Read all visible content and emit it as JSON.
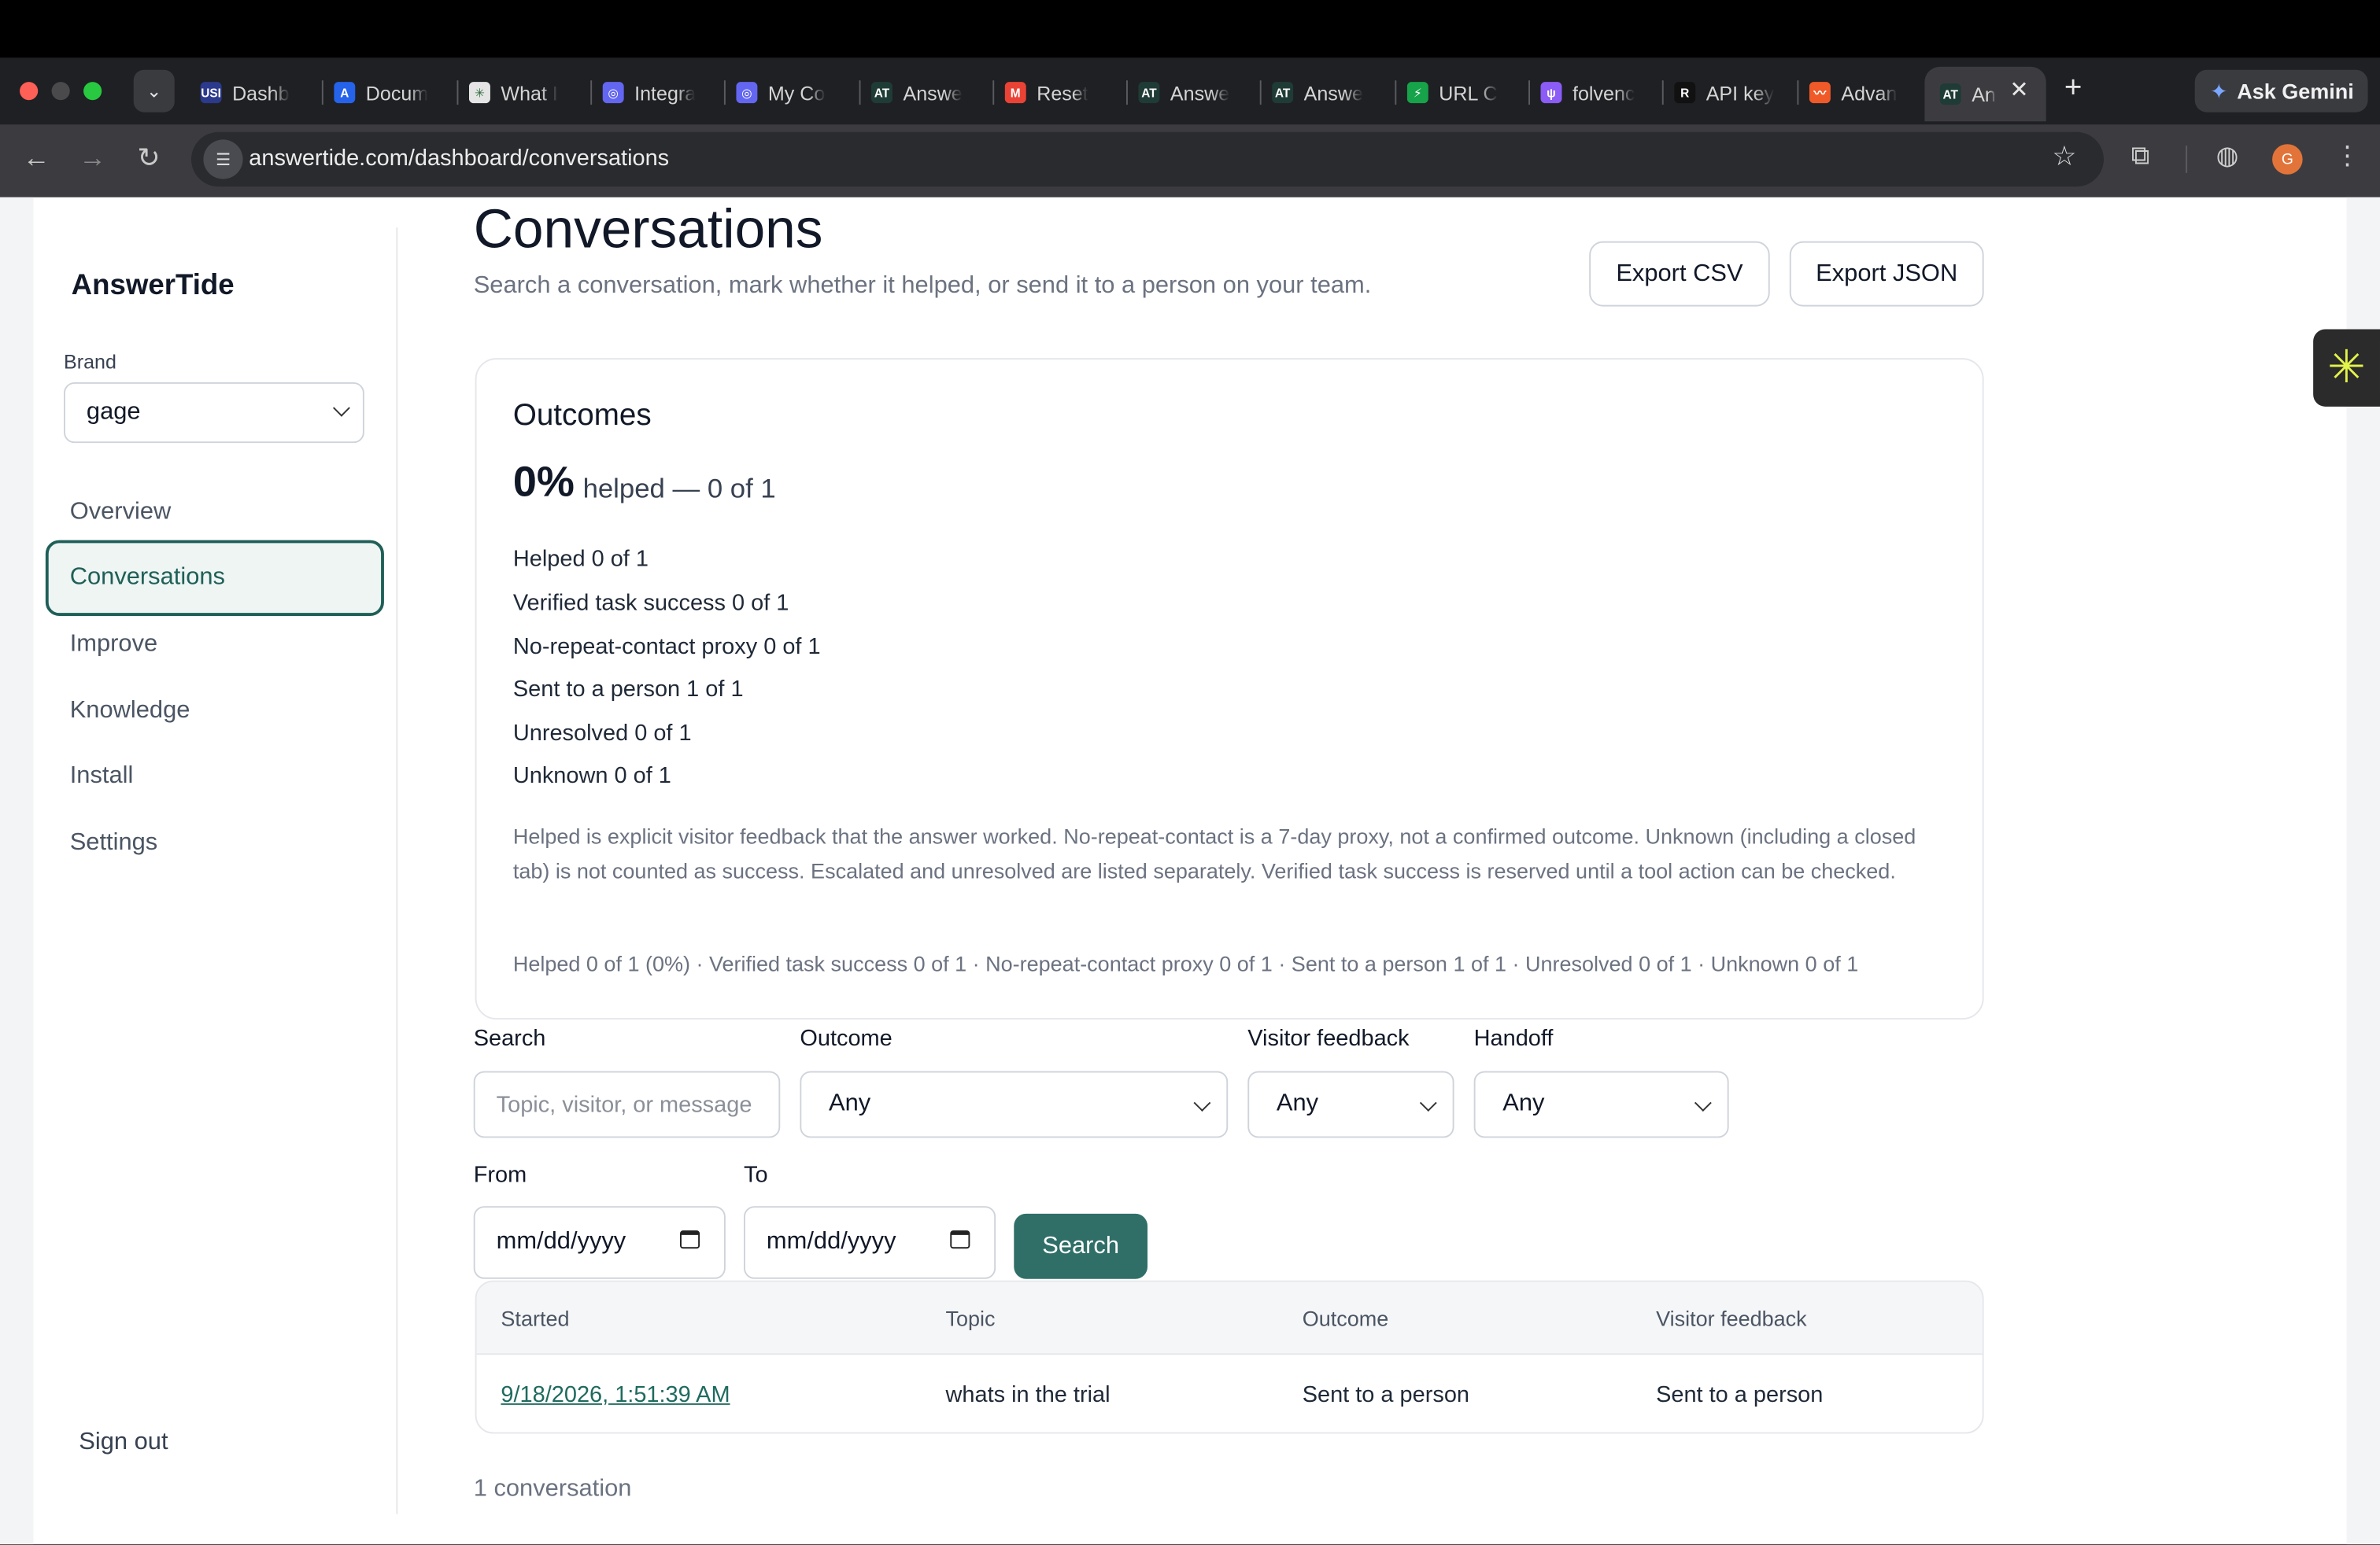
{
  "browser": {
    "tabs": [
      {
        "label": "Dashb",
        "fav": "USI",
        "color": "#2b3a8c"
      },
      {
        "label": "Docum",
        "fav": "A",
        "color": "#2563eb"
      },
      {
        "label": "What I",
        "fav": "✳",
        "color": "#e5e5e5"
      },
      {
        "label": "Integra",
        "fav": "◎",
        "color": "#6366f1"
      },
      {
        "label": "My Co",
        "fav": "◎",
        "color": "#6366f1"
      },
      {
        "label": "Answe",
        "fav": "AT",
        "color": "#1f3b35"
      },
      {
        "label": "Reset",
        "fav": "M",
        "color": "#ea4335"
      },
      {
        "label": "Answe",
        "fav": "AT",
        "color": "#1f3b35"
      },
      {
        "label": "Answe",
        "fav": "AT",
        "color": "#1f3b35"
      },
      {
        "label": "URL C",
        "fav": "⚡",
        "color": "#16a34a"
      },
      {
        "label": "folvenc",
        "fav": "ψ",
        "color": "#8b5cf6"
      },
      {
        "label": "API key",
        "fav": "R",
        "color": "#111111"
      },
      {
        "label": "Advan",
        "fav": "〰",
        "color": "#f05a28"
      }
    ],
    "active_tab": {
      "label": "An",
      "fav": "AT"
    },
    "gemini_label": "Ask Gemini",
    "url": "answertide.com/dashboard/conversations",
    "profile_initial": "G"
  },
  "sidebar": {
    "brand_name": "AnswerTide",
    "brand_label": "Brand",
    "brand_value": "gage",
    "items": [
      "Overview",
      "Conversations",
      "Improve",
      "Knowledge",
      "Install",
      "Settings"
    ],
    "active_item": "Conversations",
    "sign_out": "Sign out"
  },
  "header": {
    "title": "Conversations",
    "subtitle": "Search a conversation, mark whether it helped, or send it to a person on your team.",
    "export_csv": "Export CSV",
    "export_json": "Export JSON"
  },
  "outcomes": {
    "title": "Outcomes",
    "percent": "0%",
    "percent_sub": "helped — 0 of 1",
    "lines": [
      "Helped 0 of 1",
      "Verified task success 0 of 1",
      "No-repeat-contact proxy 0 of 1",
      "Sent to a person 1 of 1",
      "Unresolved 0 of 1",
      "Unknown 0 of 1"
    ],
    "explanation": "Helped is explicit visitor feedback that the answer worked. No-repeat-contact is a 7-day proxy, not a confirmed outcome. Unknown (including a closed tab) is not counted as success. Escalated and unresolved are listed separately. Verified task success is reserved until a tool action can be checked.",
    "summary": "Helped 0 of 1 (0%) · Verified task success 0 of 1 · No-repeat-contact proxy 0 of 1 · Sent to a person 1 of 1 · Unresolved 0 of 1 · Unknown 0 of 1"
  },
  "filters": {
    "search_label": "Search",
    "search_placeholder": "Topic, visitor, or message",
    "outcome_label": "Outcome",
    "outcome_value": "Any",
    "feedback_label": "Visitor feedback",
    "feedback_value": "Any",
    "handoff_label": "Handoff",
    "handoff_value": "Any",
    "from_label": "From",
    "from_value": "mm/dd/yyyy",
    "to_label": "To",
    "to_value": "mm/dd/yyyy",
    "search_button": "Search"
  },
  "table": {
    "columns": [
      "Started",
      "Topic",
      "Outcome",
      "Visitor feedback"
    ],
    "rows": [
      {
        "started": "9/18/2026, 1:51:39 AM",
        "topic": "whats in the trial",
        "outcome": "Sent to a person",
        "feedback": "Sent to a person"
      }
    ]
  },
  "count_text": "1 conversation"
}
